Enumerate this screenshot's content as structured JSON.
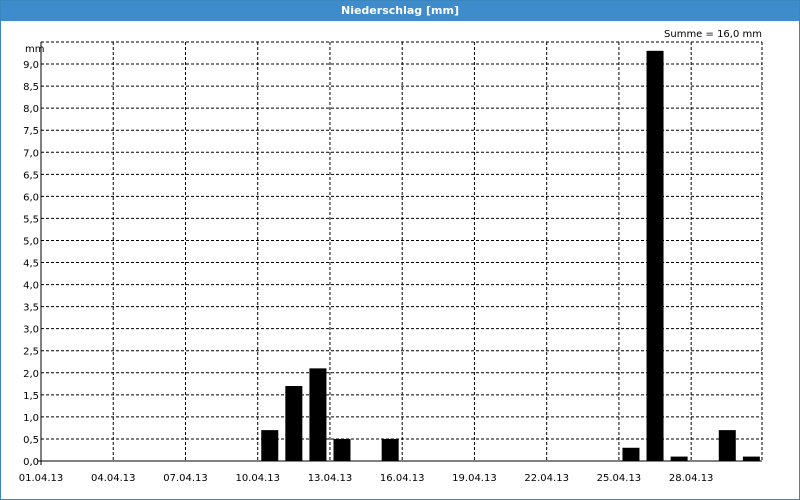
{
  "window": {
    "title": "Niederschlag [mm]"
  },
  "colors": {
    "titlebar": "#3e8ccb",
    "bar": "#000000",
    "grid": "#000000"
  },
  "chart_data": {
    "type": "bar",
    "title": "Niederschlag [mm]",
    "ylabel": "mm",
    "xlabel": "",
    "annotation": "Summe = 16,0 mm",
    "ylim": [
      0,
      9.5
    ],
    "grid": true,
    "y_ticks": [
      {
        "value": 0.0,
        "label": "0,0"
      },
      {
        "value": 0.5,
        "label": "0,5"
      },
      {
        "value": 1.0,
        "label": "1,0"
      },
      {
        "value": 1.5,
        "label": "1,5"
      },
      {
        "value": 2.0,
        "label": "2,0"
      },
      {
        "value": 2.5,
        "label": "2,5"
      },
      {
        "value": 3.0,
        "label": "3,0"
      },
      {
        "value": 3.5,
        "label": "3,5"
      },
      {
        "value": 4.0,
        "label": "4,0"
      },
      {
        "value": 4.5,
        "label": "4,5"
      },
      {
        "value": 5.0,
        "label": "5,0"
      },
      {
        "value": 5.5,
        "label": "5,5"
      },
      {
        "value": 6.0,
        "label": "6,0"
      },
      {
        "value": 6.5,
        "label": "6,5"
      },
      {
        "value": 7.0,
        "label": "7,0"
      },
      {
        "value": 7.5,
        "label": "7,5"
      },
      {
        "value": 8.0,
        "label": "8,0"
      },
      {
        "value": 8.5,
        "label": "8,5"
      },
      {
        "value": 9.0,
        "label": "9,0"
      }
    ],
    "x_tick_labels": [
      "01.04.13",
      "04.04.13",
      "07.04.13",
      "10.04.13",
      "13.04.13",
      "16.04.13",
      "19.04.13",
      "22.04.13",
      "25.04.13",
      "28.04.13"
    ],
    "categories": [
      "01.04.13",
      "02.04.13",
      "03.04.13",
      "04.04.13",
      "05.04.13",
      "06.04.13",
      "07.04.13",
      "08.04.13",
      "09.04.13",
      "10.04.13",
      "11.04.13",
      "12.04.13",
      "13.04.13",
      "14.04.13",
      "15.04.13",
      "16.04.13",
      "17.04.13",
      "18.04.13",
      "19.04.13",
      "20.04.13",
      "21.04.13",
      "22.04.13",
      "23.04.13",
      "24.04.13",
      "25.04.13",
      "26.04.13",
      "27.04.13",
      "28.04.13",
      "29.04.13",
      "30.04.13"
    ],
    "values": [
      0,
      0,
      0,
      0,
      0,
      0,
      0,
      0,
      0,
      0.7,
      1.7,
      2.1,
      0.5,
      0,
      0.5,
      0,
      0,
      0,
      0,
      0,
      0,
      0,
      0,
      0,
      0.3,
      9.3,
      0.1,
      0,
      0.7,
      0.1
    ]
  }
}
